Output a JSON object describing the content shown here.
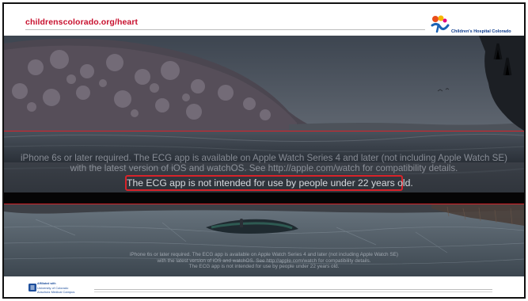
{
  "header": {
    "url_text": "childrenscolorado.org/heart",
    "logo": {
      "icon": "childrens-hospital-colorado-logo-icon",
      "text": "Children's Hospital Colorado"
    }
  },
  "video_top": {
    "caption_lines": [
      "iPhone 6s or later required. The ECG app is available on Apple Watch Series 4 and later (not including Apple Watch SE)",
      "with the latest version of iOS and watchOS. See http://apple.com/watch for compatibility details."
    ],
    "highlighted_line": "The ECG app is not intended for use by people under 22 years old."
  },
  "video_bottom": {
    "caption_lines": [
      "iPhone 6s or later required. The ECG app is available on Apple Watch Series 4 and later (not including Apple Watch SE)",
      "with the latest version of iOS and watchOS. See http://apple.com/watch for compatibility details.",
      "The ECG app is not intended for use by people under 22 years old."
    ]
  },
  "footer": {
    "affiliation_label": "Affiliated with",
    "university_line_1": "University of Colorado",
    "university_line_2": "Anschutz Medical Campus",
    "logo_icon": "cu-anschutz-logo-icon"
  },
  "colors": {
    "url_red": "#c8102e",
    "highlight_red": "#d8232a",
    "cu_blue": "#1e4f9c"
  }
}
